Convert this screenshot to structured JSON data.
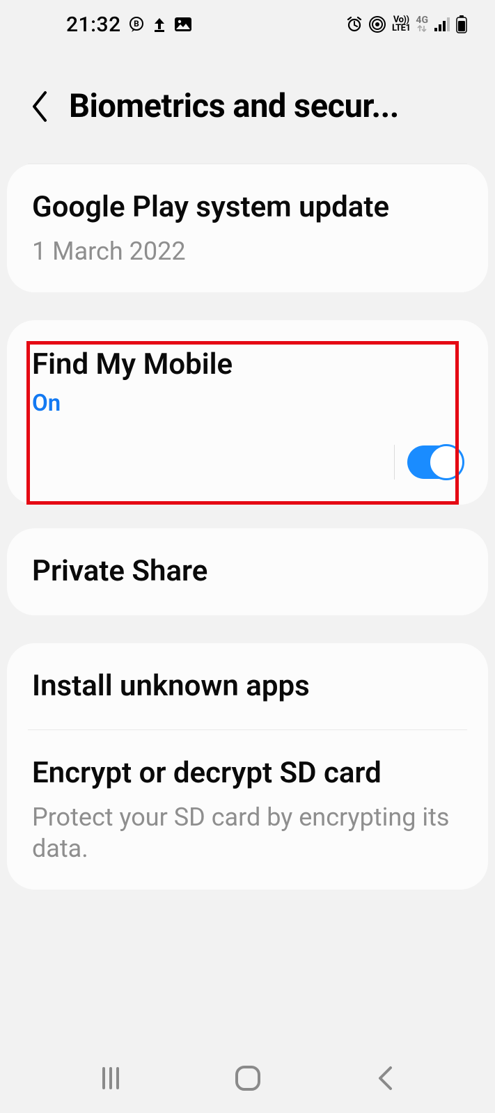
{
  "status": {
    "time": "21:32",
    "lte_top": "Vo))",
    "lte_bot": "LTE1",
    "fourg": "4G"
  },
  "header": {
    "title": "Biometrics and secur..."
  },
  "card_update": {
    "title": "Google Play system update",
    "subtitle": "1 March 2022"
  },
  "find": {
    "title": "Find My Mobile",
    "status": "On"
  },
  "private_share": {
    "title": "Private Share"
  },
  "install_unknown": {
    "title": "Install unknown apps"
  },
  "encrypt": {
    "title": "Encrypt or decrypt SD card",
    "subtitle": "Protect your SD card by encrypting its data."
  }
}
